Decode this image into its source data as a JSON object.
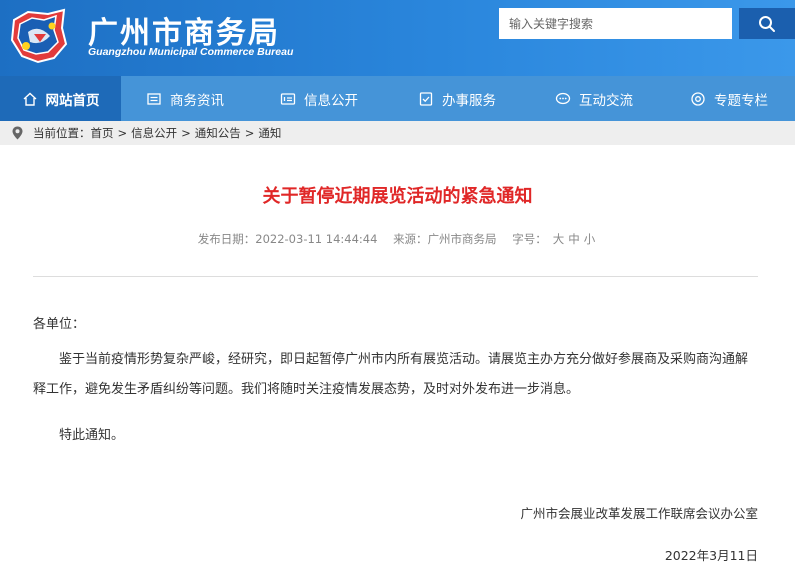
{
  "header": {
    "title": "广州市商务局",
    "subtitle": "Guangzhou Municipal Commerce Bureau",
    "logo_icon": "city-emblem-icon",
    "search": {
      "placeholder": "输入关键字搜索",
      "button_icon": "search-icon"
    }
  },
  "nav": {
    "items": [
      {
        "label": "网站首页",
        "icon": "home-icon"
      },
      {
        "label": "商务资讯",
        "icon": "news-icon"
      },
      {
        "label": "信息公开",
        "icon": "info-icon"
      },
      {
        "label": "办事服务",
        "icon": "service-icon"
      },
      {
        "label": "互动交流",
        "icon": "chat-icon"
      },
      {
        "label": "专题专栏",
        "icon": "topic-icon"
      }
    ],
    "active_index": 0
  },
  "breadcrumb": {
    "prefix": "当前位置：",
    "items": [
      "首页",
      "信息公开",
      "通知公告",
      "通知"
    ],
    "separator": ">"
  },
  "article": {
    "title": "关于暂停近期展览活动的紧急通知",
    "date_label": "发布日期：",
    "date_value": "2022-03-11 14:44:44",
    "source_label": "来源：",
    "source_value": "广州市商务局",
    "font_label": "字号：",
    "font_sizes": [
      "大",
      "中",
      "小"
    ],
    "salutation": "各单位：",
    "paragraph1": "鉴于当前疫情形势复杂严峻，经研究，即日起暂停广州市内所有展览活动。请展览主办方充分做好参展商及采购商沟通解释工作，避免发生矛盾纠纷等问题。我们将随时关注疫情发展态势，及时对外发布进一步消息。",
    "paragraph2": "特此通知。",
    "signature": "广州市会展业改革发展工作联席会议办公室",
    "sign_date": "2022年3月11日"
  },
  "colors": {
    "header_bg": "#2a86dc",
    "nav_bg": "#4594d8",
    "nav_active": "#1e6ab8",
    "title_red": "#e02727"
  }
}
